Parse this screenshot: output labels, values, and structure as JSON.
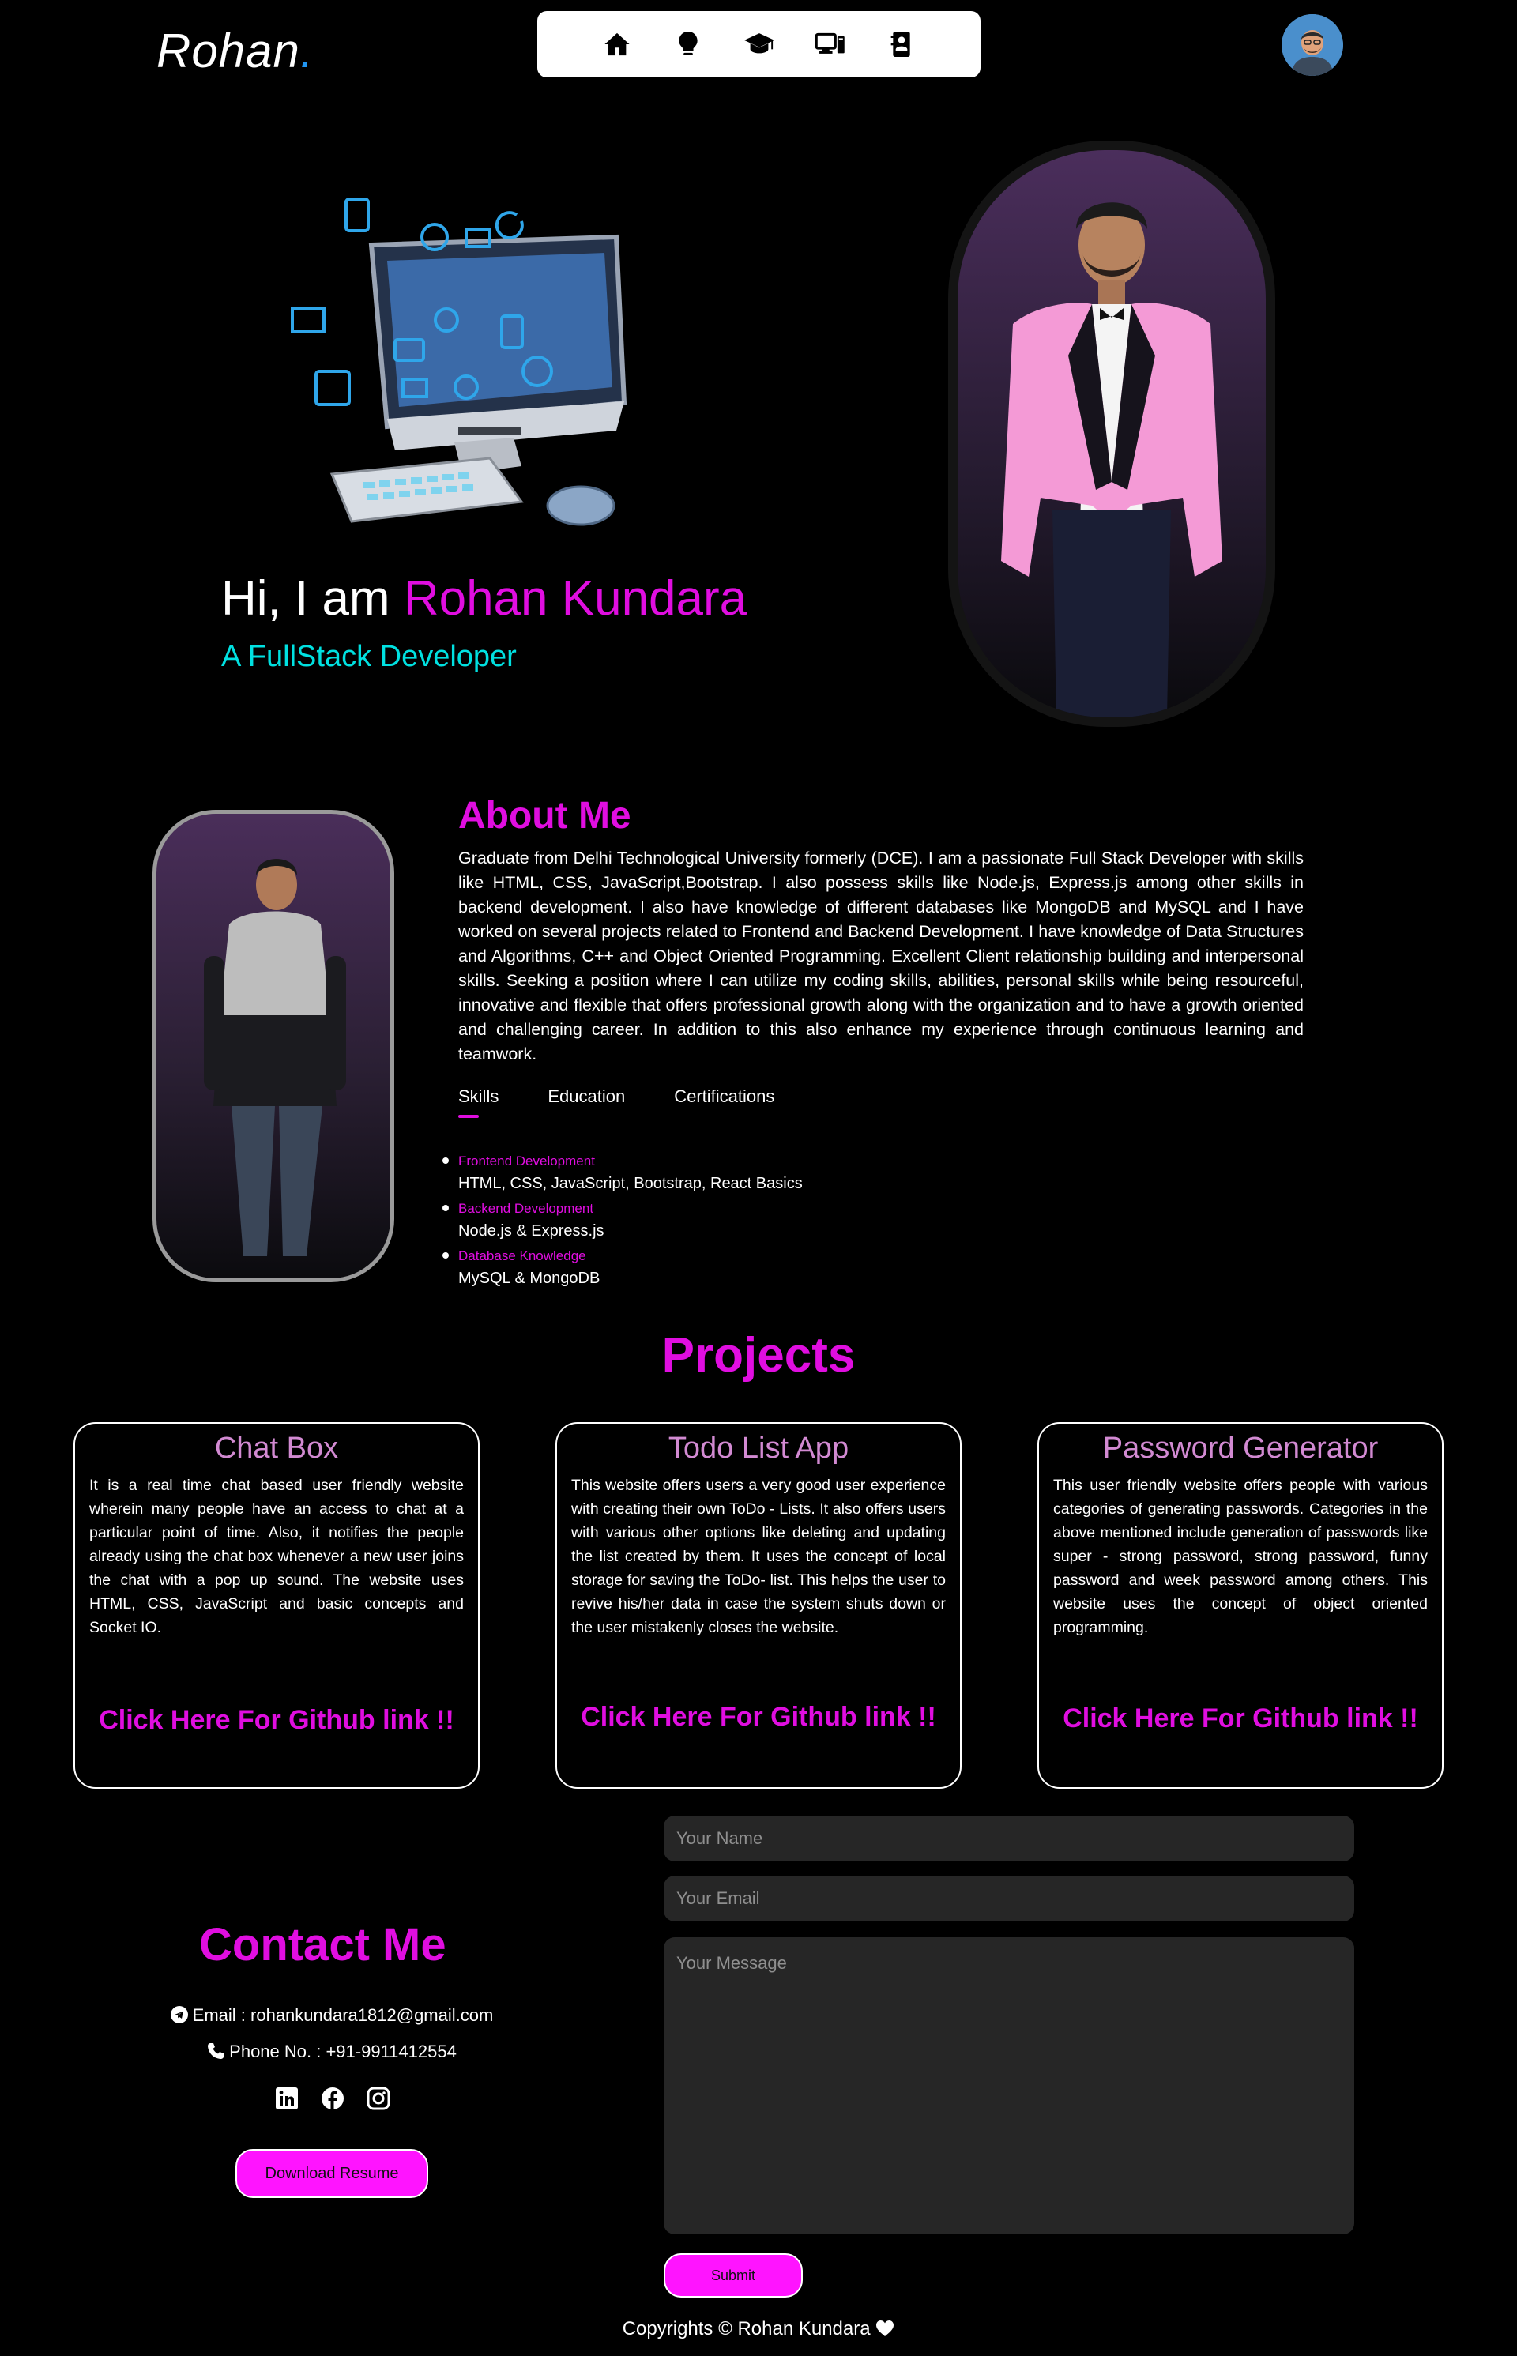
{
  "header": {
    "logo_text": "Rohan",
    "logo_dot": ".",
    "nav": [
      {
        "icon": "home-icon"
      },
      {
        "icon": "lightbulb-icon"
      },
      {
        "icon": "graduation-cap-icon"
      },
      {
        "icon": "laptop-icon"
      },
      {
        "icon": "contact-book-icon"
      }
    ],
    "avatar_icon": "avatar-icon"
  },
  "hero": {
    "greeting": "Hi, I am ",
    "name": "Rohan Kundara",
    "role": "A FullStack Developer"
  },
  "about": {
    "title": "About Me",
    "text": "Graduate from Delhi Technological University formerly (DCE). I am a passionate Full Stack Developer with skills like HTML, CSS, JavaScript,Bootstrap. I also possess skills like Node.js, Express.js among other skills in backend development. I also have knowledge of different databases like MongoDB and MySQL and I have worked on several projects related to Frontend and Backend Development. I have knowledge of Data Structures and Algorithms, C++ and Object Oriented Programming. Excellent Client relationship building and interpersonal skills. Seeking a position where I can utilize my coding skills, abilities, personal skills while being resourceful, innovative and flexible that offers professional growth along with the organization and to have a growth oriented and challenging career. In addition to this also enhance my experience through continuous learning and teamwork.",
    "tabs": [
      "Skills",
      "Education",
      "Certifications"
    ],
    "active_tab": "Skills",
    "skills": [
      {
        "title": "Frontend Development",
        "desc": "HTML, CSS, JavaScript, Bootstrap, React Basics"
      },
      {
        "title": "Backend Development",
        "desc": "Node.js & Express.js"
      },
      {
        "title": "Database Knowledge",
        "desc": "MySQL & MongoDB"
      }
    ]
  },
  "projects": {
    "title": "Projects",
    "items": [
      {
        "title": "Chat Box",
        "desc": "It is a real time chat based user friendly website wherein many people have an access to chat at a particular point of time. Also, it notifies the people already using the chat box whenever a new user joins the chat with a pop up sound. The website uses HTML, CSS, JavaScript and basic concepts and Socket IO.",
        "link": "Click Here For Github link !!"
      },
      {
        "title": "Todo List App",
        "desc": "This website offers users a very good user experience with creating their own ToDo - Lists. It also offers users with various other options like deleting and updating the list created by them. It uses the concept of local storage for saving the ToDo- list. This helps the user to revive his/her data in case the system shuts down or the user mistakenly closes the website.",
        "link": "Click Here For Github link !!"
      },
      {
        "title": "Password Generator",
        "desc": "This user friendly website offers people with various categories of generating passwords. Categories in the above mentioned include generation of passwords like super - strong password, strong password, funny password and week password among others. This website uses the concept of object oriented programming.",
        "link": "Click Here For Github link !!"
      }
    ]
  },
  "contact": {
    "title": "Contact Me",
    "email": "Email : rohankundara1812@gmail.com",
    "phone": "Phone No. : +91-9911412554",
    "socials": [
      "linkedin-icon",
      "facebook-icon",
      "instagram-icon"
    ],
    "resume_button": "Download Resume",
    "form": {
      "name_placeholder": "Your Name",
      "email_placeholder": "Your Email",
      "message_placeholder": "Your Message",
      "submit_label": "Submit"
    }
  },
  "footer": {
    "text": "Copyrights © Rohan Kundara",
    "heart_icon": "heart-icon"
  },
  "colors": {
    "accent": "#e00ee0",
    "button": "#ff14ff",
    "role": "#00e0e0",
    "logo_dot": "#2196f3",
    "background": "#000000"
  }
}
